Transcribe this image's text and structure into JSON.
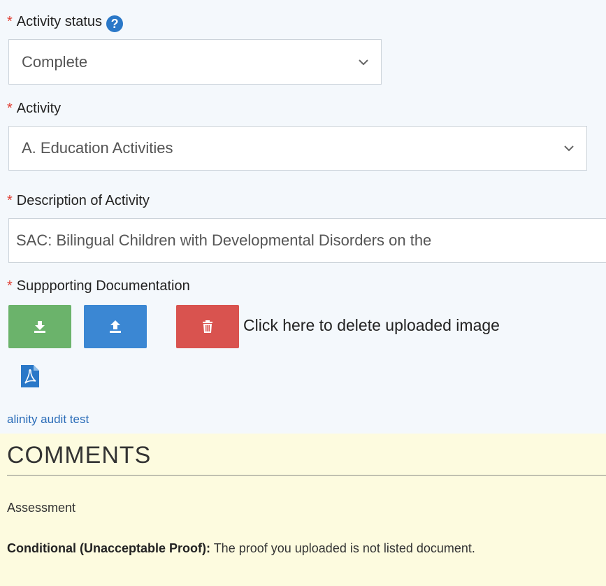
{
  "activity_status": {
    "label": "Activity status",
    "required_mark": "*",
    "help_glyph": "?",
    "selected": "Complete"
  },
  "activity": {
    "label": "Activity",
    "required_mark": "*",
    "selected": "A. Education Activities"
  },
  "description": {
    "label": "Description of Activity",
    "required_mark": "*",
    "value": "SAC: Bilingual Children with Developmental Disorders on the"
  },
  "documentation": {
    "label": "Suppporting Documentation",
    "required_mark": "*",
    "delete_text": "Click here to delete uploaded image",
    "file_name": "alinity audit test",
    "colors": {
      "download": "#6bb36b",
      "upload": "#3b87d3",
      "delete": "#d9534f",
      "pdf": "#2a78c8"
    },
    "icons": {
      "download": "download-icon",
      "upload": "upload-icon",
      "delete": "trash-icon",
      "file": "pdf-file-icon"
    }
  },
  "comments": {
    "title": "COMMENTS",
    "assessment_label": "Assessment",
    "status_bold": "Conditional (Unacceptable Proof):",
    "status_text": " The proof you uploaded is not listed document.",
    "background": "#fdfbdf"
  }
}
